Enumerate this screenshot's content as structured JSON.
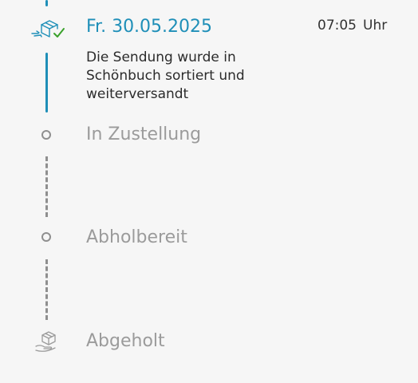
{
  "colors": {
    "accent": "#1f8fb8",
    "check": "#3aa12b",
    "pending": "#9b9b9b"
  },
  "timeline": {
    "current": {
      "icon": "package-sorted-check-icon",
      "date": "Fr. 30.05.2025",
      "time": "07:05",
      "time_unit": "Uhr",
      "description_lines": [
        "Die Sendung wurde in",
        "Schönbuch sortiert und",
        "weiterversandt"
      ]
    },
    "steps": [
      {
        "label": "In Zustellung",
        "icon": "circle-icon"
      },
      {
        "label": "Abholbereit",
        "icon": "circle-icon"
      },
      {
        "label": "Abgeholt",
        "icon": "package-pickup-icon"
      }
    ]
  }
}
